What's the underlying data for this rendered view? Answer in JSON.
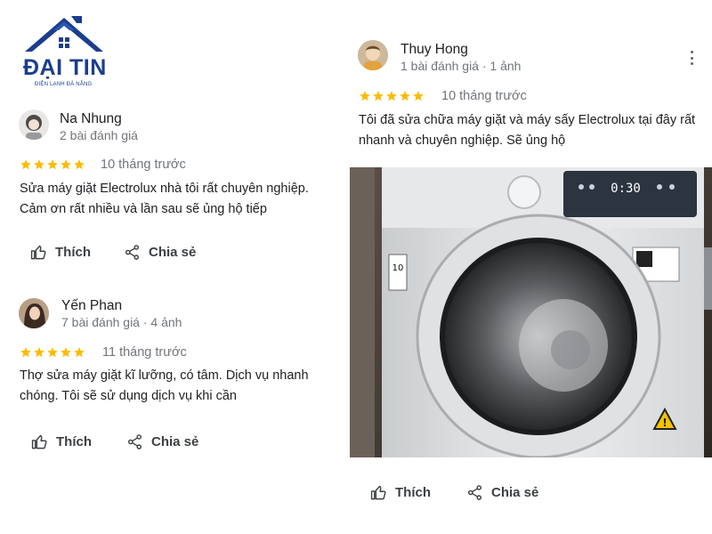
{
  "brand": {
    "name": "ĐẠI TIN",
    "tagline": "ĐIỆN LẠNH ĐÀ NẴNG",
    "color": "#1b3e8c"
  },
  "colors": {
    "star": "#fbbc04",
    "text": "#202124",
    "meta": "#70757a"
  },
  "actions": {
    "like_label": "Thích",
    "share_label": "Chia sẻ",
    "like_icon": "thumbs-up-icon",
    "share_icon": "share-icon"
  },
  "reviews": [
    {
      "name": "Na Nhung",
      "meta": "2 bài đánh giá",
      "rating": 5,
      "time": "10 tháng trước",
      "text": "Sửa máy giặt Electrolux nhà tôi rất chuyên nghiệp. Cảm ơn rất nhiều và lần sau sẽ ủng hộ tiếp"
    },
    {
      "name": "Yến Phan",
      "meta": "7 bài đánh giá · 4 ảnh",
      "rating": 5,
      "time": "11 tháng trước",
      "text": "Thợ sửa máy giặt kĩ lưỡng, có tâm. Dịch vụ nhanh chóng. Tôi sẽ sử dụng dịch vụ khi cần"
    },
    {
      "name": "Thuy Hong",
      "meta": "1 bài đánh giá · 1 ảnh",
      "rating": 5,
      "time": "10 tháng trước",
      "text": "Tôi đã sửa chữa máy giặt và máy sấy Electrolux tại đây rất nhanh và chuyên nghiệp. Sẽ ủng hộ",
      "photo": {
        "display": "0:30",
        "badge": "10"
      }
    }
  ]
}
